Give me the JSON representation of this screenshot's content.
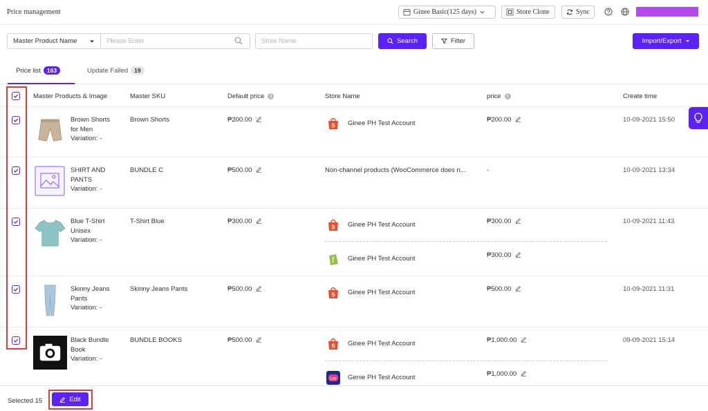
{
  "header": {
    "title": "Price management",
    "plan_label": "Ginee Basic(125 days)",
    "store_clone_label": "Store Clone",
    "sync_label": "Sync"
  },
  "filters": {
    "field_select": "Master Product Name",
    "search_placeholder": "Please Enter",
    "store_placeholder": "Store Name",
    "search_label": "Search",
    "filter_label": "Filter",
    "import_export_label": "Import/Export"
  },
  "tabs": [
    {
      "label": "Price list",
      "count": "163",
      "active": true
    },
    {
      "label": "Update Failed",
      "count": "19",
      "active": false
    }
  ],
  "columns": {
    "product": "Master Products & Image",
    "sku": "Master SKU",
    "default_price": "Default price",
    "store": "Store Name",
    "price": "price",
    "create_time": "Create time"
  },
  "rows": [
    {
      "name_lines": [
        "Brown Shorts",
        "for Men"
      ],
      "variation": "Variation: -",
      "sku": "Brown Shorts",
      "default_price": "₱200.00",
      "stores": [
        {
          "name": "Ginee PH Test Account",
          "logo": "shopee-icon",
          "price": "₱200.00"
        }
      ],
      "create_time": "10-09-2021 15:50",
      "thumb": "shorts-image"
    },
    {
      "name_lines": [
        "SHIRT AND",
        "PANTS"
      ],
      "variation": "Variation: -",
      "sku": "BUNDLE C",
      "default_price": "₱500.00",
      "stores": [
        {
          "name": "Non-channel products (WooCommerce does n...",
          "logo": "",
          "price": "-"
        }
      ],
      "create_time": "10-09-2021 13:34",
      "thumb": "image-placeholder-icon"
    },
    {
      "name_lines": [
        "Blue T-Shirt",
        "Unisex"
      ],
      "variation": "Variation: -",
      "sku": "T-Shirt Blue",
      "default_price": "₱300.00",
      "stores": [
        {
          "name": "Ginee PH Test Account",
          "logo": "shopee-icon",
          "price": "₱300.00"
        },
        {
          "name": "Ginee PH Test Account",
          "logo": "shopify-icon",
          "price": "₱300.00"
        }
      ],
      "create_time": "10-09-2021 11:43",
      "thumb": "tshirt-image"
    },
    {
      "name_lines": [
        "Skinny Jeans",
        "Pants"
      ],
      "variation": "Variation: -",
      "sku": "Skinny Jeans Pants",
      "default_price": "₱500.00",
      "stores": [
        {
          "name": "Ginee PH Test Account",
          "logo": "shopee-icon",
          "price": "₱500.00"
        }
      ],
      "create_time": "10-09-2021 11:31",
      "thumb": "jeans-image"
    },
    {
      "name_lines": [
        "Black Bundle",
        "Book"
      ],
      "variation": "Variation: -",
      "sku": "BUNDLE BOOKS",
      "default_price": "₱500.00",
      "stores": [
        {
          "name": "Ginee PH Test Account",
          "logo": "shopee-icon",
          "price": "₱1,000.00"
        },
        {
          "name": "Genie PH Test Account",
          "logo": "lazada-icon",
          "price": "₱1,000.00"
        }
      ],
      "create_time": "09-09-2021 15:14",
      "thumb": "camera-image"
    }
  ],
  "footer": {
    "selected_text": "Selected 15",
    "edit_label": "Edit"
  },
  "colors": {
    "accent": "#5b21f5",
    "highlight_frame": "#e53935",
    "shopee": "#ee4d2d",
    "shopify": "#95bf47",
    "user_bar": "#b34bea"
  }
}
